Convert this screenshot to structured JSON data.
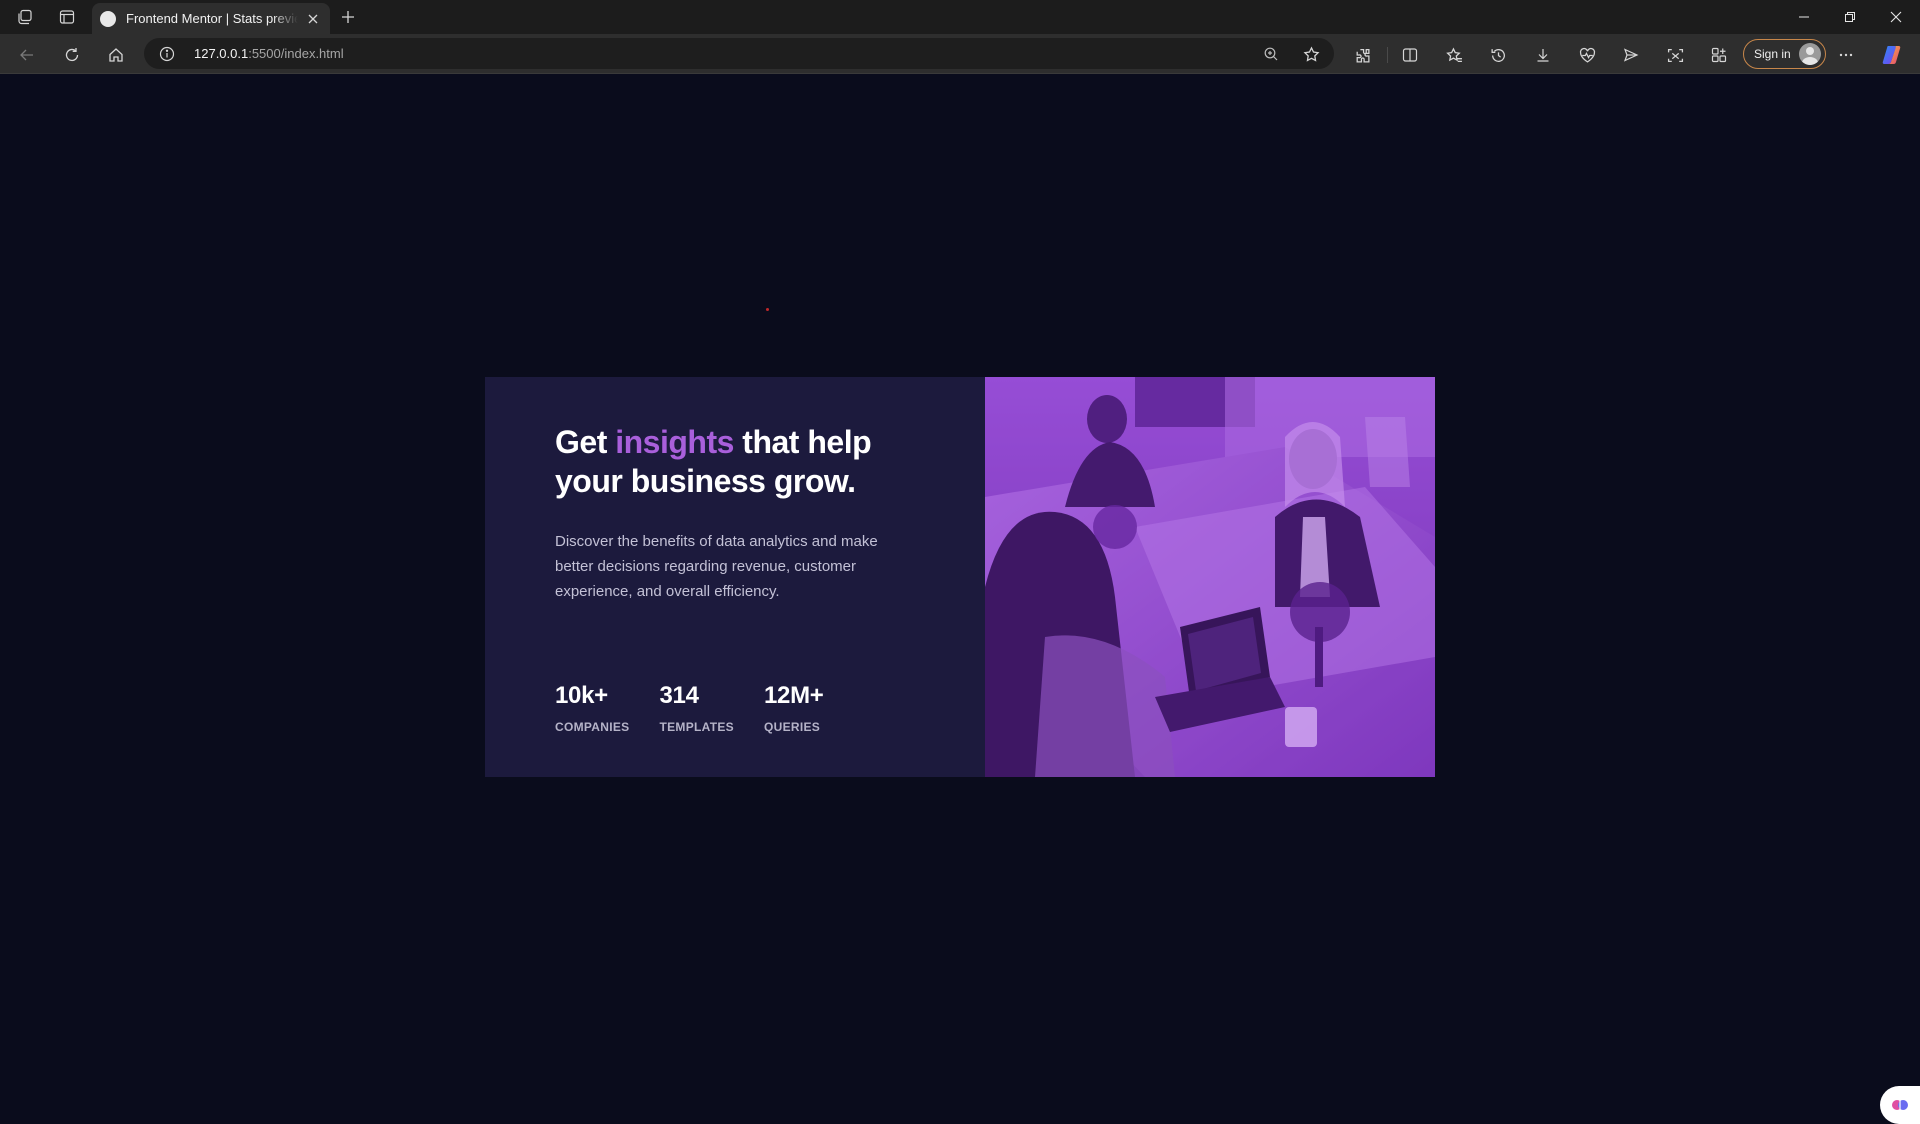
{
  "browser": {
    "tab": {
      "title": "Frontend Mentor | Stats preview card component"
    },
    "address": {
      "host": "127.0.0.1",
      "path": ":5500/index.html"
    },
    "signin_label": "Sign in"
  },
  "card": {
    "heading_pre": "Get ",
    "heading_accent": "insights",
    "heading_post": " that help your business grow.",
    "description": "Discover the benefits of data analytics and make better decisions regarding revenue, customer experience, and overall efficiency.",
    "stats": [
      {
        "value": "10k+",
        "label": "COMPANIES"
      },
      {
        "value": "314",
        "label": "TEMPLATES"
      },
      {
        "value": "12M+",
        "label": "QUERIES"
      }
    ],
    "image_tint": "#8d3fd0"
  },
  "colors": {
    "page_bg": "#0a0c1c",
    "card_bg": "#1c1a3d",
    "accent": "#a95fdb"
  }
}
